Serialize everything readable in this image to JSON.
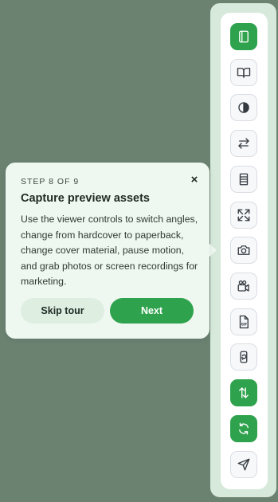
{
  "tour": {
    "step": "STEP 8 OF 9",
    "close_glyph": "×",
    "title": "Capture preview assets",
    "body": "Use the viewer controls to switch angles, change from hardcover to paperback, change cover material, pause motion, and grab photos or screen recordings for marketing.",
    "skip_label": "Skip tour",
    "next_label": "Next"
  },
  "toolbar": {
    "items": [
      {
        "icon": "notebook-icon",
        "active": true
      },
      {
        "icon": "open-book-icon",
        "active": false
      },
      {
        "icon": "contrast-icon",
        "active": false
      },
      {
        "icon": "swap-arrows-icon",
        "active": false
      },
      {
        "icon": "book-spine-icon",
        "active": false
      },
      {
        "icon": "expand-icon",
        "active": false
      },
      {
        "icon": "camera-icon",
        "active": false
      },
      {
        "icon": "video-camera-icon",
        "active": false
      },
      {
        "icon": "gif-file-icon",
        "active": false
      },
      {
        "icon": "phone-rotate-icon",
        "active": false
      },
      {
        "icon": "vertical-swap-icon",
        "active": true
      },
      {
        "icon": "refresh-icon",
        "active": true
      },
      {
        "icon": "send-icon",
        "active": false
      }
    ]
  },
  "colors": {
    "backdrop": "#6b8271",
    "accent": "#2fa24d",
    "toolbar_frame": "#d7e9da",
    "popover_bg": "#eef7f0"
  }
}
